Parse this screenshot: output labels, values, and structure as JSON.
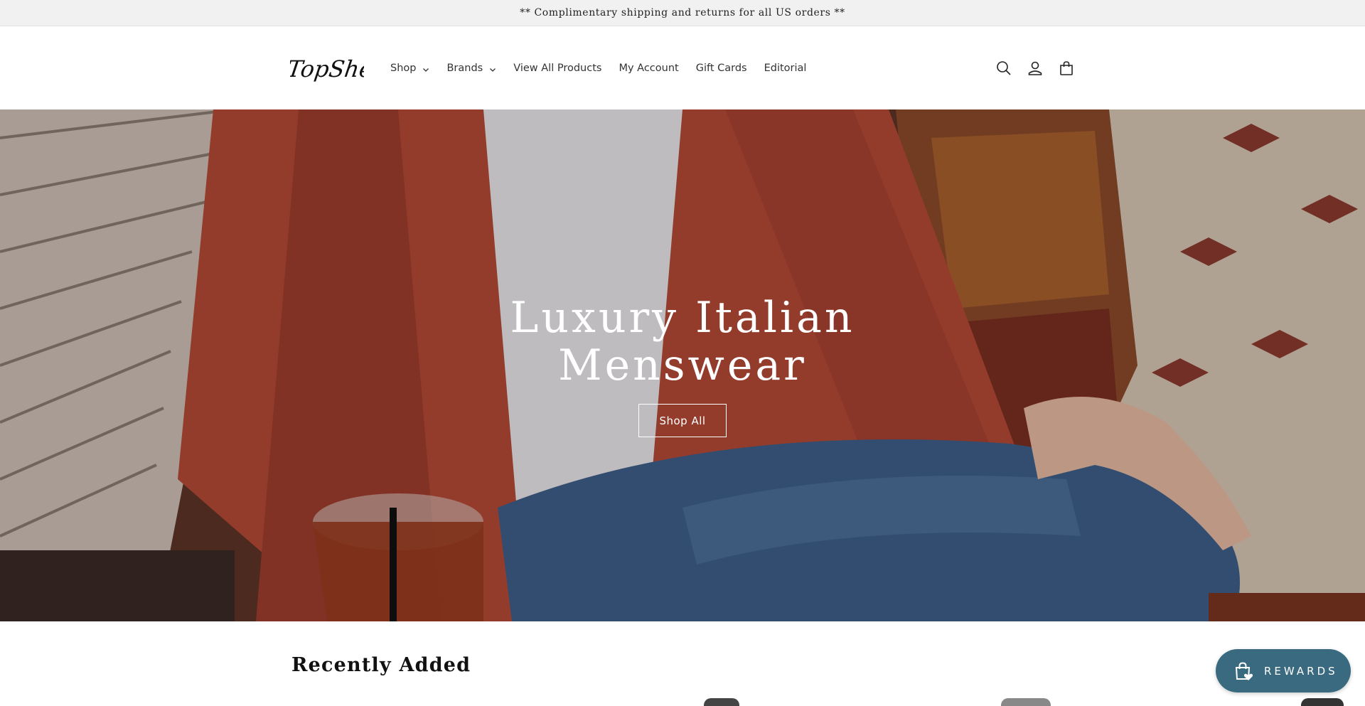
{
  "announcement": {
    "text": "** Complimentary shipping and returns for all US orders **"
  },
  "header": {
    "logo_text": "TopShelf",
    "nav": [
      {
        "label": "Shop",
        "dropdown": true
      },
      {
        "label": "Brands",
        "dropdown": true
      },
      {
        "label": "View All Products",
        "dropdown": false
      },
      {
        "label": "My Account",
        "dropdown": false
      },
      {
        "label": "Gift Cards",
        "dropdown": false
      },
      {
        "label": "Editorial",
        "dropdown": false
      }
    ],
    "icons": [
      "search-icon",
      "account-icon",
      "cart-icon"
    ]
  },
  "hero": {
    "title_line1": "Luxury Italian",
    "title_line2": "Menswear",
    "cta_label": "Shop All"
  },
  "recently_added": {
    "title": "Recently Added"
  },
  "rewards": {
    "label": "REWARDS",
    "color": "#3a6a80"
  }
}
